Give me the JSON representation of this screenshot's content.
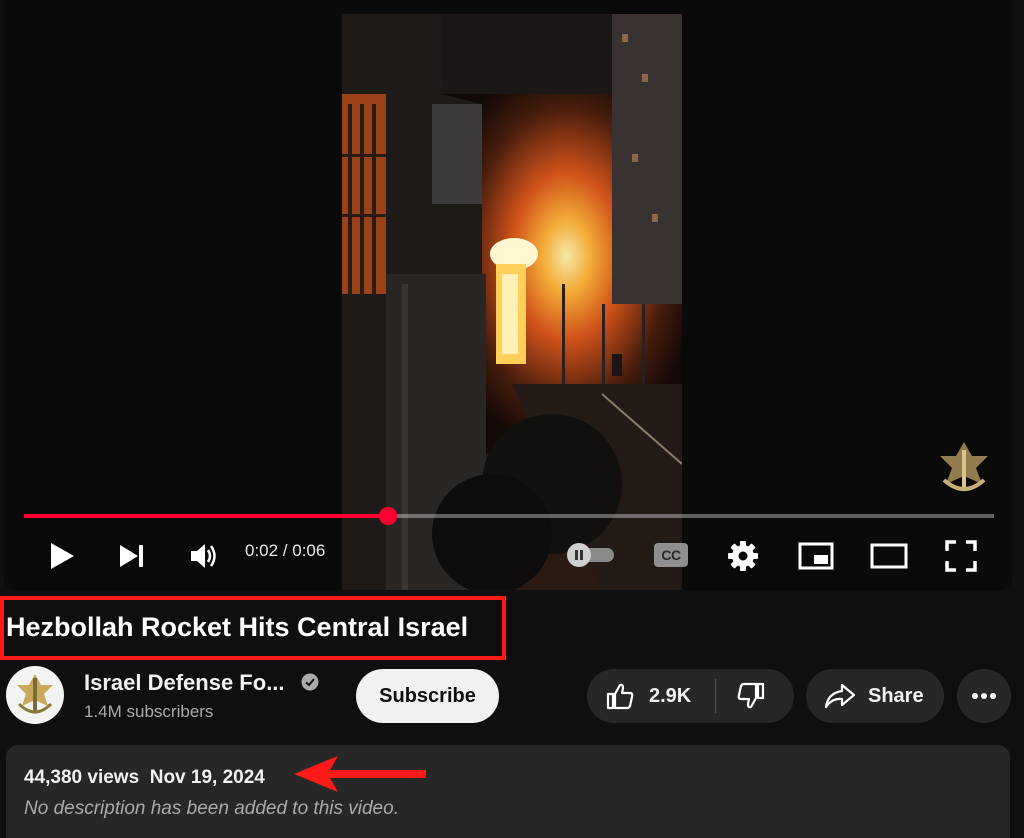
{
  "player": {
    "time_display": "0:02 / 0:06",
    "progress_fraction": 0.375,
    "accent_color": "#ff0033",
    "captions_label": "CC",
    "icons": [
      "play-icon",
      "next-icon",
      "volume-icon",
      "autoplay-toggle",
      "captions-icon",
      "settings-gear-icon",
      "miniplayer-icon",
      "theater-mode-icon",
      "fullscreen-icon"
    ]
  },
  "video": {
    "title": "Hezbollah Rocket Hits Central Israel"
  },
  "channel": {
    "name": "Israel Defense Fo...",
    "subscribers": "1.4M subscribers",
    "subscribe_label": "Subscribe"
  },
  "actions": {
    "like_count": "2.9K",
    "share_label": "Share"
  },
  "description": {
    "views": "44,380 views",
    "date": "Nov 19, 2024",
    "text": "No description has been added to this video."
  },
  "annotation_color": "#ff1a1a"
}
